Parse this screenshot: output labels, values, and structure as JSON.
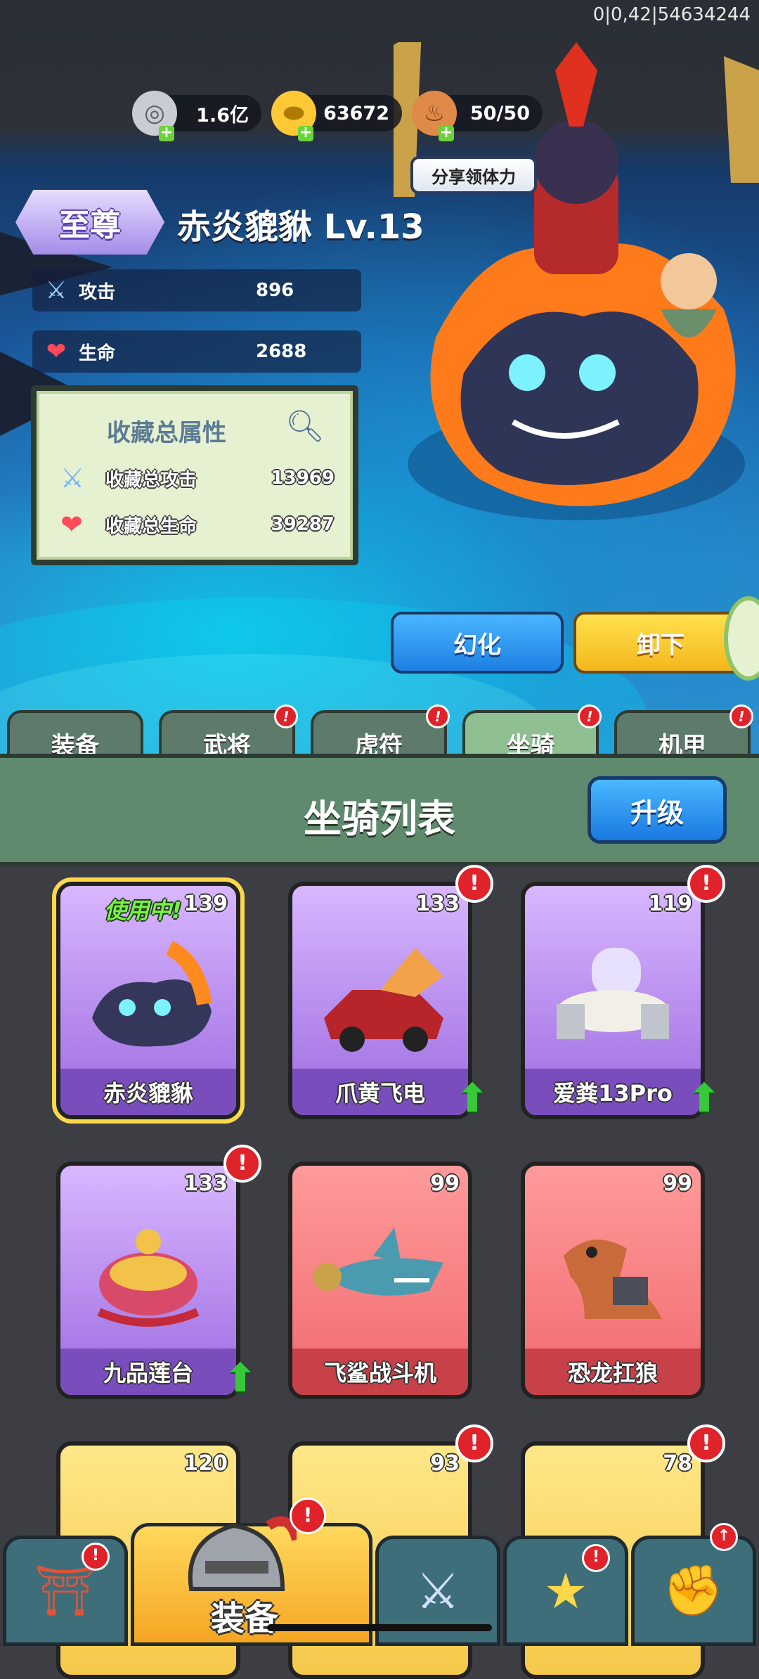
{
  "status_code": "0|0,42|54634244",
  "resources": [
    {
      "icon": "silver-coin-icon",
      "value": "1.6亿"
    },
    {
      "icon": "gold-ingot-icon",
      "value": "63672"
    },
    {
      "icon": "meat-icon",
      "value": "50/50"
    }
  ],
  "share_button": "分享领体力",
  "mount": {
    "rank": "至尊",
    "title": "赤炎貔貅 Lv.13",
    "stats": [
      {
        "icon": "sword-icon",
        "label": "攻击",
        "value": "896"
      },
      {
        "icon": "heart-icon",
        "label": "生命",
        "value": "2688"
      }
    ]
  },
  "collection": {
    "title": "收藏总属性",
    "rows": [
      {
        "icon": "sword-icon",
        "label": "收藏总攻击",
        "value": "13969"
      },
      {
        "icon": "heart-icon",
        "label": "收藏总生命",
        "value": "39287"
      }
    ]
  },
  "actions": {
    "transform": "幻化",
    "unequip": "卸下"
  },
  "tabs": [
    {
      "label": "装备",
      "badge": ""
    },
    {
      "label": "武将",
      "badge": "!"
    },
    {
      "label": "虎符",
      "badge": "!"
    },
    {
      "label": "坐骑",
      "badge": "!"
    },
    {
      "label": "机甲",
      "badge": "!"
    }
  ],
  "list": {
    "title": "坐骑列表",
    "upgrade": "升级"
  },
  "cards": [
    {
      "name": "赤炎貔貅",
      "level": "139",
      "status": "使用中!",
      "color": "purple",
      "alert": false,
      "upgrade": false
    },
    {
      "name": "爪黄飞电",
      "level": "133",
      "status": "",
      "color": "purple",
      "alert": true,
      "upgrade": true
    },
    {
      "name": "爱粪13Pro",
      "level": "119",
      "status": "",
      "color": "purple",
      "alert": true,
      "upgrade": true
    },
    {
      "name": "九品莲台",
      "level": "133",
      "status": "",
      "color": "purple",
      "alert": true,
      "upgrade": true
    },
    {
      "name": "飞鲨战斗机",
      "level": "99",
      "status": "",
      "color": "red",
      "alert": false,
      "upgrade": false
    },
    {
      "name": "恐龙扛狼",
      "level": "99",
      "status": "",
      "color": "red",
      "alert": false,
      "upgrade": false
    },
    {
      "name": "",
      "level": "120",
      "status": "",
      "color": "gold",
      "alert": false,
      "upgrade": false
    },
    {
      "name": "",
      "level": "93",
      "status": "",
      "color": "gold",
      "alert": true,
      "upgrade": false
    },
    {
      "name": "",
      "level": "78",
      "status": "",
      "color": "gold",
      "alert": true,
      "upgrade": false
    }
  ],
  "bottom_nav": {
    "active_label": "装备",
    "badge": "!",
    "up_arrow": "↑"
  }
}
